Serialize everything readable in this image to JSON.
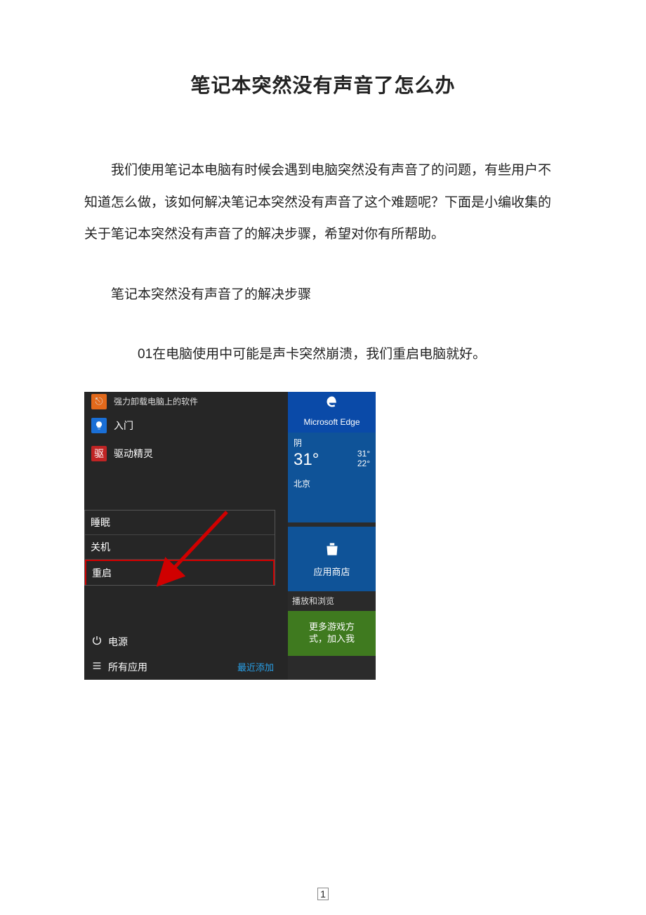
{
  "doc": {
    "title": "笔记本突然没有声音了怎么办",
    "intro": "我们使用笔记本电脑有时候会遇到电脑突然没有声音了的问题，有些用户不知道怎么做，该如何解决笔记本突然没有声音了这个难题呢？下面是小编收集的关于笔记本突然没有声音了的解决步骤，希望对你有所帮助。",
    "subhead": "笔记本突然没有声音了的解决步骤",
    "step01": "01在电脑使用中可能是声卡突然崩溃，我们重启电脑就好。",
    "page_number": "1"
  },
  "screenshot": {
    "left_top_small": "强力卸载电脑上的软件",
    "left_items": [
      {
        "label": "入门"
      },
      {
        "label": "驱动精灵"
      }
    ],
    "power_menu": {
      "sleep": "睡眠",
      "shutdown": "关机",
      "restart": "重启"
    },
    "bottom": {
      "power": "电源",
      "all_apps": "所有应用",
      "recent": "最近添加"
    },
    "right": {
      "edge_label": "Microsoft Edge",
      "weather": {
        "cond": "阴",
        "temp_main": "31°",
        "temp_hi": "31°",
        "temp_lo": "22°",
        "city": "北京"
      },
      "store_label": "应用商店",
      "browse_label": "播放和浏览",
      "green_line1": "更多游戏方",
      "green_line2": "式，加入我"
    }
  }
}
